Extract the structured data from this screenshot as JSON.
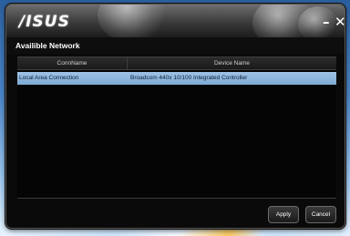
{
  "window": {
    "logo_text": "/ISUS",
    "minimize_label": "–",
    "close_label": "✕"
  },
  "page": {
    "title": "Availible Network"
  },
  "table": {
    "columns": [
      "ConnName",
      "Device Name"
    ],
    "rows": [
      {
        "conn_name": "Local Area Connection",
        "device_name": "Broadcom 440x 10/100 Integrated Controller",
        "selected": true
      }
    ]
  },
  "buttons": {
    "apply_label": "Apply",
    "cancel_label": "Cancel"
  },
  "colors": {
    "window_bg": "#0a0a0a",
    "selected_row": "#8fb6dd",
    "desktop_accent": "#4b86c8"
  }
}
